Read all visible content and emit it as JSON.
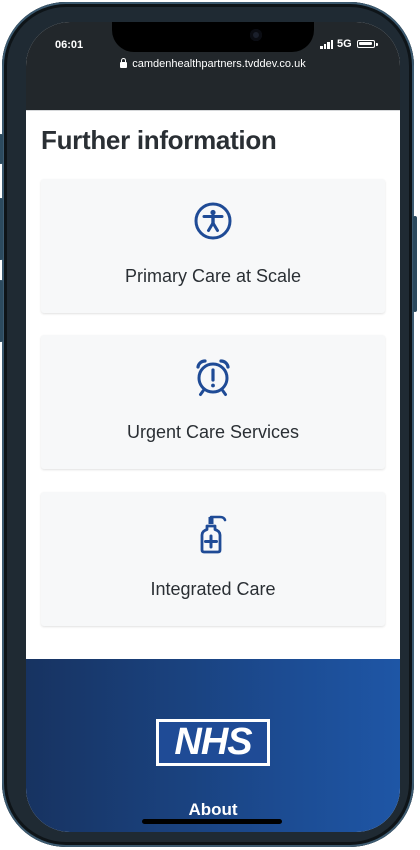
{
  "status_bar": {
    "time": "06:01",
    "network": "5G"
  },
  "browser": {
    "url": "camdenhealthpartners.tvddev.co.uk"
  },
  "section": {
    "title": "Further information"
  },
  "cards": [
    {
      "label": "Primary Care at Scale",
      "icon": "accessibility-icon"
    },
    {
      "label": "Urgent Care Services",
      "icon": "alarm-clock-icon"
    },
    {
      "label": "Integrated Care",
      "icon": "sanitizer-bottle-icon"
    }
  ],
  "footer": {
    "logo_text": "NHS",
    "about_label": "About"
  },
  "colors": {
    "accent": "#1f4b96",
    "heading": "#2a2f34",
    "footer_start": "#173361",
    "footer_end": "#1e56a6"
  }
}
